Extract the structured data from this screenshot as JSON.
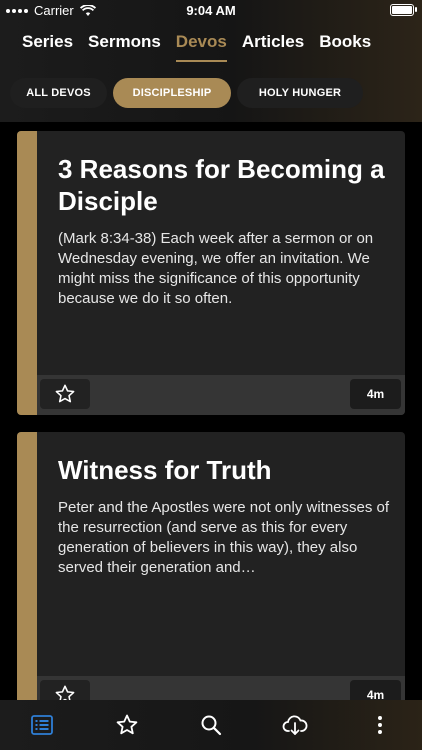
{
  "status_bar": {
    "carrier": "Carrier",
    "time": "9:04 AM"
  },
  "top_tabs": [
    {
      "label": "Series",
      "active": false
    },
    {
      "label": "Sermons",
      "active": false
    },
    {
      "label": "Devos",
      "active": true
    },
    {
      "label": "Articles",
      "active": false
    },
    {
      "label": "Books",
      "active": false
    }
  ],
  "filter_chips": [
    {
      "label": "ALL DEVOS",
      "active": false
    },
    {
      "label": "DISCIPLESHIP",
      "active": true
    },
    {
      "label": "HOLY HUNGER",
      "active": false
    }
  ],
  "cards": [
    {
      "title": "3 Reasons for Becoming a Disciple",
      "excerpt": "(Mark 8:34-38) Each week after a sermon or on Wednesday evening, we offer an invitation.  We might miss the significance of this opportunity because we do it so often.",
      "duration": "4m"
    },
    {
      "title": "Witness for Truth",
      "excerpt": "Peter and the Apostles were not only witnesses of the resurrection (and serve as this for every generation of believers in this way), they also served their generation and…",
      "duration": "4m"
    }
  ],
  "bottom_tabs": [
    {
      "icon": "list-icon",
      "active": true
    },
    {
      "icon": "star-icon",
      "active": false
    },
    {
      "icon": "search-icon",
      "active": false
    },
    {
      "icon": "cloud-download-icon",
      "active": false
    },
    {
      "icon": "more-vertical-icon",
      "active": false
    }
  ],
  "colors": {
    "accent": "#a98a55",
    "card_bg": "#222222",
    "footer_bg": "#353535",
    "active_blue": "#2f7fd6"
  }
}
